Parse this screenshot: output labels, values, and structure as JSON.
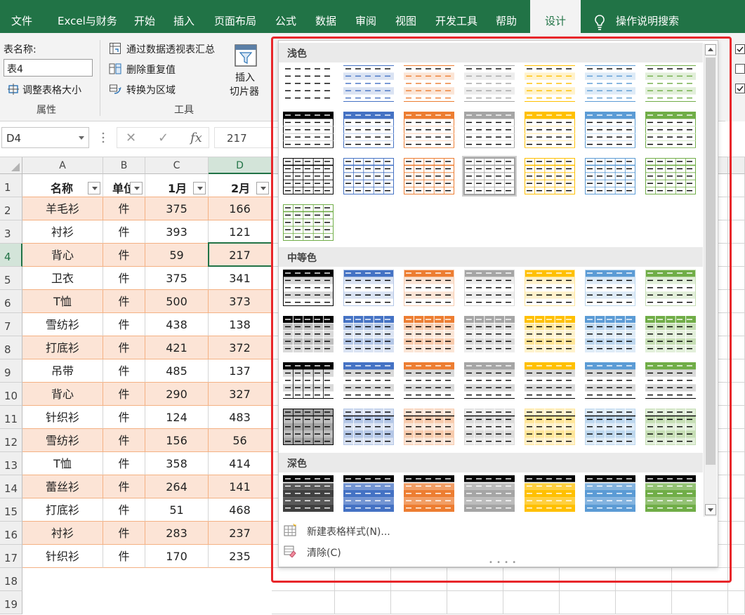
{
  "tabs": [
    "文件",
    "Excel与财务",
    "开始",
    "插入",
    "页面布局",
    "公式",
    "数据",
    "审阅",
    "视图",
    "开发工具",
    "帮助",
    "设计"
  ],
  "active_tab": "设计",
  "tell_me": "操作说明搜索",
  "ribbon": {
    "table_name_label": "表名称:",
    "table_name_value": "表4",
    "resize_table": "调整表格大小",
    "properties_group": "属性",
    "summarize_pivot": "通过数据透视表汇总",
    "remove_duplicates": "删除重复值",
    "convert_to_range": "转换为区域",
    "tools_group": "工具",
    "insert_slicer_line1": "插入",
    "insert_slicer_line2": "切片器"
  },
  "formula_bar": {
    "name_box": "D4",
    "fx": "fx",
    "value": "217"
  },
  "sheet": {
    "columns": [
      "A",
      "B",
      "C",
      "D"
    ],
    "row_numbers": [
      "1",
      "2",
      "3",
      "4",
      "5",
      "6",
      "7",
      "8",
      "9",
      "10",
      "11",
      "12",
      "13",
      "14",
      "15",
      "16",
      "17",
      "18",
      "19"
    ],
    "headers": [
      "名称",
      "单位",
      "1月",
      "2月"
    ],
    "rows": [
      [
        "羊毛衫",
        "件",
        "375",
        "166"
      ],
      [
        "衬衫",
        "件",
        "393",
        "121"
      ],
      [
        "背心",
        "件",
        "59",
        "217"
      ],
      [
        "卫衣",
        "件",
        "375",
        "341"
      ],
      [
        "T恤",
        "件",
        "500",
        "373"
      ],
      [
        "雪纺衫",
        "件",
        "438",
        "138"
      ],
      [
        "打底衫",
        "件",
        "421",
        "372"
      ],
      [
        "吊带",
        "件",
        "485",
        "137"
      ],
      [
        "背心",
        "件",
        "290",
        "327"
      ],
      [
        "针织衫",
        "件",
        "124",
        "483"
      ],
      [
        "雪纺衫",
        "件",
        "156",
        "56"
      ],
      [
        "T恤",
        "件",
        "358",
        "414"
      ],
      [
        "蕾丝衫",
        "件",
        "264",
        "141"
      ],
      [
        "打底衫",
        "件",
        "51",
        "468"
      ],
      [
        "衬衫",
        "件",
        "283",
        "237"
      ],
      [
        "针织衫",
        "件",
        "170",
        "235"
      ]
    ],
    "selected_cell": "D4"
  },
  "gallery": {
    "sections": {
      "light": "浅色",
      "medium": "中等色",
      "dark": "深色"
    },
    "accent_colors": [
      "#000000",
      "#4472c4",
      "#ed7d31",
      "#a5a5a5",
      "#ffc000",
      "#5b9bd5",
      "#70ad47"
    ],
    "new_style": "新建表格样式(N)...",
    "clear": "清除(C)",
    "highlighted_style": "浅色 第3行 第4列"
  }
}
